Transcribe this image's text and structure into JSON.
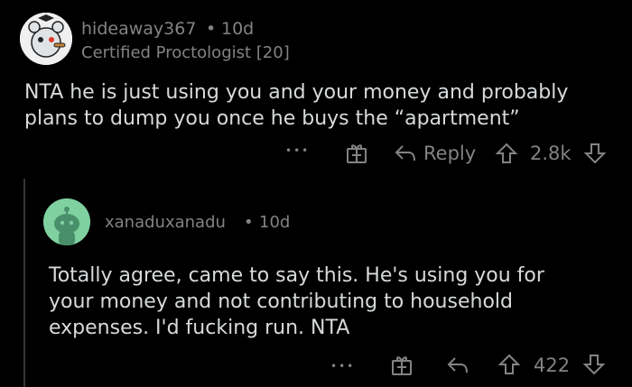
{
  "comment1": {
    "username": "hideaway367",
    "time": "10d",
    "separator": "•",
    "flair": "Certified Proctologist [20]",
    "body": "NTA he is just using you and your money and probably plans to dump you once he buys the “apartment”",
    "more_label": "•••",
    "reply_label": "Reply",
    "score": "2.8k"
  },
  "comment2": {
    "username": "xanaduxanadu",
    "time": "10d",
    "separator": "•",
    "body": "Totally agree, came to say this. He's using you for your money and not contributing to household expenses. I'd fucking run. NTA",
    "more_label": "•••",
    "score": "422"
  },
  "colors": {
    "background": "#000000",
    "text": "#d7dadc",
    "muted": "#818384",
    "avatar2_bg": "#7fd1a0"
  }
}
